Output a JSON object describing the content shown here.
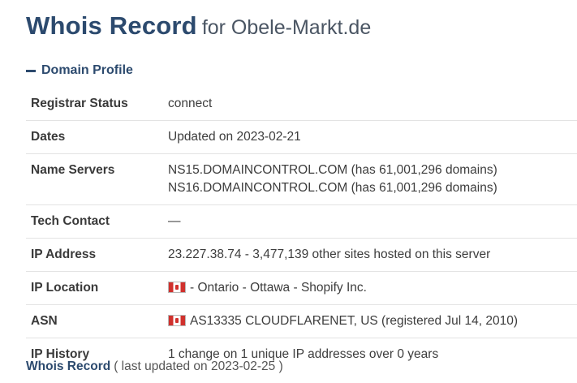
{
  "header": {
    "title": "Whois Record",
    "subtitle": "for Obele-Markt.de"
  },
  "section": {
    "toggle_icon": "minus-icon",
    "title": "Domain Profile"
  },
  "profile": {
    "registrar_status": {
      "label": "Registrar Status",
      "value": "connect"
    },
    "dates": {
      "label": "Dates",
      "value": "Updated on 2023-02-21"
    },
    "name_servers": {
      "label": "Name Servers",
      "values": [
        "NS15.DOMAINCONTROL.COM (has 61,001,296 domains)",
        "NS16.DOMAINCONTROL.COM (has 61,001,296 domains)"
      ]
    },
    "tech_contact": {
      "label": "Tech Contact",
      "value": "—"
    },
    "ip_address": {
      "label": "IP Address",
      "value": "23.227.38.74 - 3,477,139 other sites hosted on this server"
    },
    "ip_location": {
      "label": "IP Location",
      "flag": "canada-flag-icon",
      "value": "- Ontario - Ottawa - Shopify Inc."
    },
    "asn": {
      "label": "ASN",
      "flag": "canada-flag-icon",
      "value": "AS13335 CLOUDFLARENET, US (registered Jul 14, 2010)"
    },
    "ip_history": {
      "label": "IP History",
      "value": "1 change on 1 unique IP addresses over 0 years"
    }
  },
  "footer": {
    "link_label": "Whois Record",
    "note": "( last updated on 2023-02-25 )"
  },
  "colors": {
    "heading": "#2c4a6e",
    "text": "#3d3d3d",
    "row_border": "#e3e3e3",
    "flag_red": "#d0312d"
  }
}
